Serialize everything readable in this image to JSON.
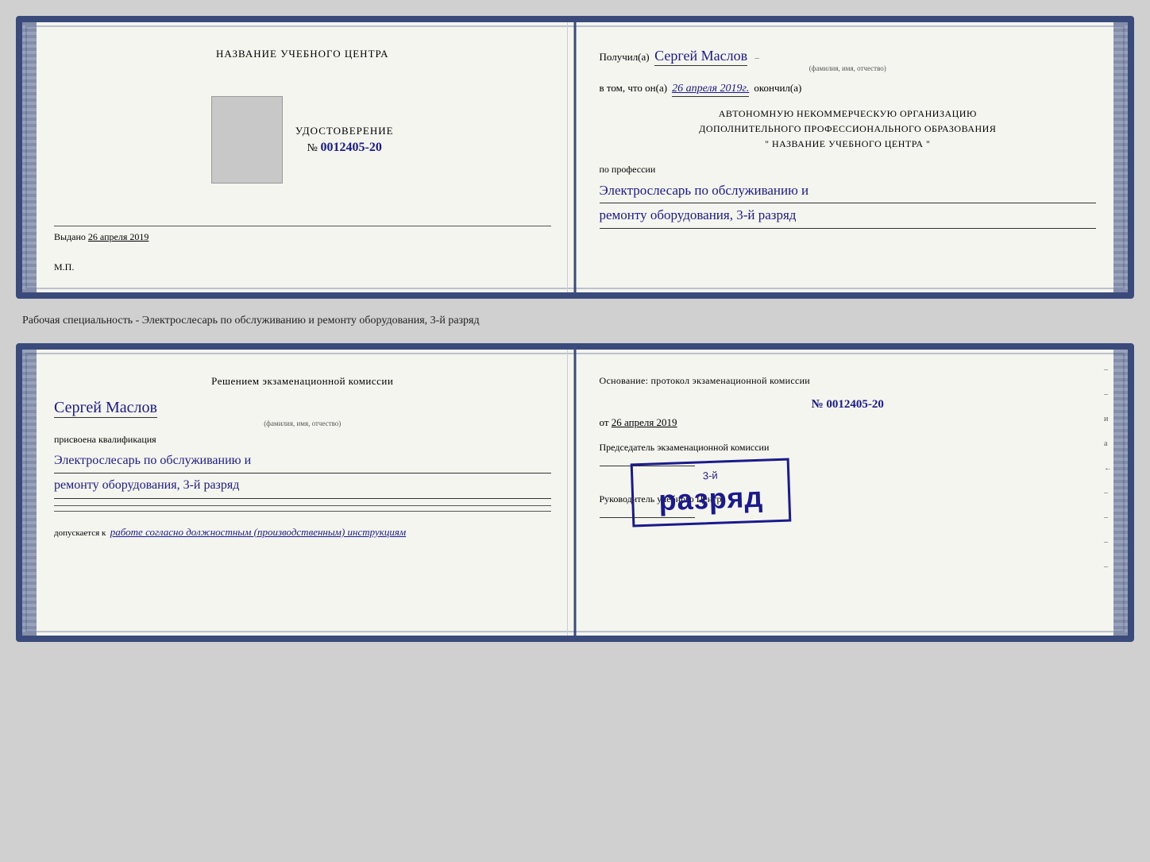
{
  "top_cert": {
    "left": {
      "training_center": "НАЗВАНИЕ УЧЕБНОГО ЦЕНТРА",
      "udostoverenie_title": "УДОСТОВЕРЕНИЕ",
      "number_prefix": "№",
      "number_value": "0012405-20",
      "vydano_label": "Выдано",
      "vydano_date": "26 апреля 2019",
      "mp_label": "М.П."
    },
    "right": {
      "poluchil_label": "Получил(а)",
      "recipient_name": "Сергей Маслов",
      "fio_label": "(фамилия, имя, отчество)",
      "vtom_prefix": "в том, что он(а)",
      "vtom_date": "26 апреля 2019г.",
      "vtom_suffix": "окончил(а)",
      "org_line1": "АВТОНОМНУЮ НЕКОММЕРЧЕСКУЮ ОРГАНИЗАЦИЮ",
      "org_line2": "ДОПОЛНИТЕЛЬНОГО ПРОФЕССИОНАЛЬНОГО ОБРАЗОВАНИЯ",
      "org_line3": "\"    НАЗВАНИЕ УЧЕБНОГО ЦЕНТРА    \"",
      "po_professii": "по профессии",
      "profession_line1": "Электрослесарь по обслуживанию и",
      "profession_line2": "ремонту оборудования, 3-й разряд"
    }
  },
  "between_text": "Рабочая специальность - Электрослесарь по обслуживанию и ремонту оборудования, 3-й разряд",
  "bottom_cert": {
    "left": {
      "resheniem_title": "Решением экзаменационной комиссии",
      "recipient_name": "Сергей Маслов",
      "fio_label": "(фамилия, имя, отчество)",
      "prisvoena": "присвоена квалификация",
      "qual_line1": "Электрослесарь по обслуживанию и",
      "qual_line2": "ремонту оборудования, 3-й разряд",
      "dopusk_prefix": "допускается к",
      "dopusk_text": "работе согласно должностным (производственным) инструкциям"
    },
    "right": {
      "osnovanie_label": "Основание: протокол экзаменационной комиссии",
      "number_prefix": "№",
      "protocol_number": "0012405-20",
      "ot_prefix": "от",
      "ot_date": "26 апреля 2019",
      "chairman_label": "Председатель экзаменационной комиссии",
      "rukovoditel_label": "Руководитель учебного Центра"
    },
    "stamp": {
      "prefix": "3-й",
      "main": "разряд"
    }
  }
}
